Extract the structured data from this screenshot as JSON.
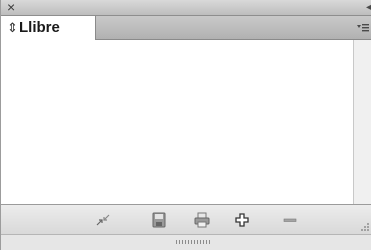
{
  "window": {
    "close_glyph": "×",
    "collapse_glyph": "◂◂"
  },
  "tab": {
    "label": "Llibre",
    "arrows_glyph": "⇕"
  },
  "toolbar": {
    "buttons": [
      {
        "name": "synchronize-icon"
      },
      {
        "name": "save-book-icon"
      },
      {
        "name": "print-book-icon"
      },
      {
        "name": "add-document-icon"
      },
      {
        "name": "remove-document-icon"
      }
    ]
  },
  "colors": {
    "titlebar": "#c8c8c8",
    "tabbar": "#bdbdbd",
    "tab_active": "#ffffff",
    "bottombar": "#e1e1e1",
    "icon": "#5a5a5a"
  }
}
